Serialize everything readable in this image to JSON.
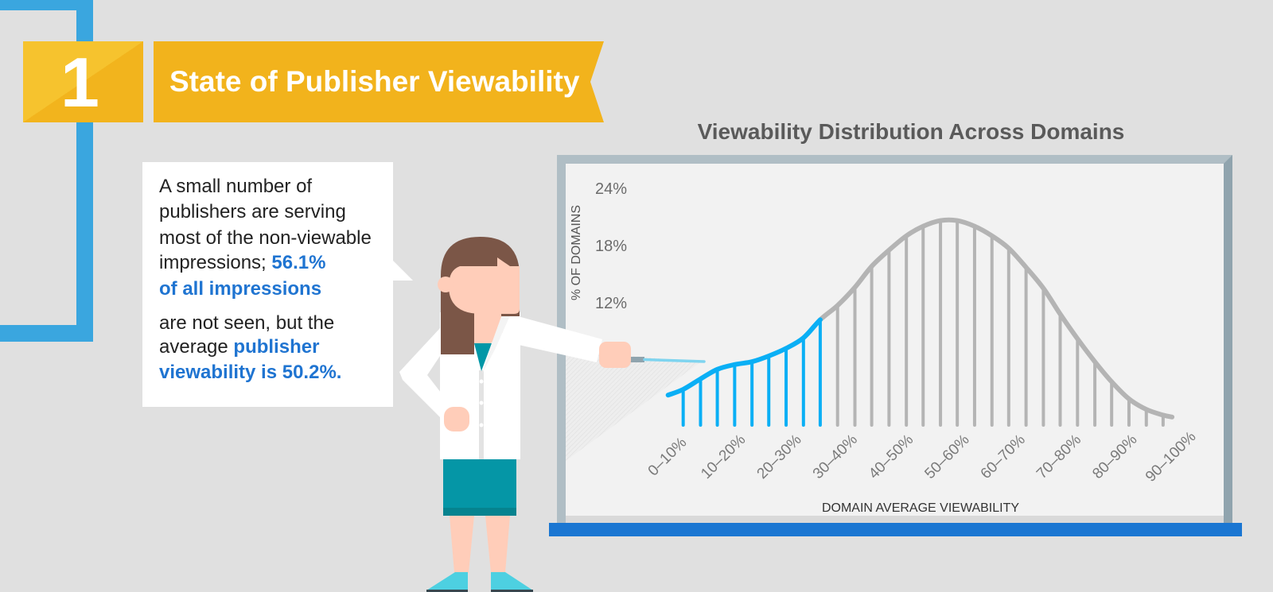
{
  "header": {
    "section_number": "1",
    "section_title": "State of Publisher Viewability"
  },
  "bubble": {
    "lines": [
      {
        "segments": [
          {
            "text": "A small number of",
            "emphasis": false
          }
        ]
      },
      {
        "segments": [
          {
            "text": "publishers are serving",
            "emphasis": false
          }
        ]
      },
      {
        "segments": [
          {
            "text": "most of the non-viewable",
            "emphasis": false
          }
        ]
      },
      {
        "segments": [
          {
            "text": "impressions; ",
            "emphasis": false
          },
          {
            "text": "56.1%",
            "emphasis": true
          }
        ]
      },
      {
        "segments": [
          {
            "text": "of all impressions",
            "emphasis": true
          }
        ]
      },
      {
        "segments": [
          {
            "text": "are not seen, but the",
            "emphasis": false
          }
        ]
      },
      {
        "segments": [
          {
            "text": "average ",
            "emphasis": false
          },
          {
            "text": "publisher",
            "emphasis": true
          }
        ]
      },
      {
        "segments": [
          {
            "text": "viewability is 50.2%.",
            "emphasis": true
          }
        ]
      }
    ]
  },
  "chart_data": {
    "type": "line",
    "title": "Viewability Distribution Across Domains",
    "xlabel": "DOMAIN AVERAGE VIEWABILITY",
    "ylabel": "% OF DOMAINS",
    "categories": [
      "0–10%",
      "10–20%",
      "20–30%",
      "30–40%",
      "40–50%",
      "50–60%",
      "60–70%",
      "70–80%",
      "80–90%",
      "90–100%"
    ],
    "xlim": [
      0,
      100
    ],
    "ylim": [
      0,
      24
    ],
    "yticks": [
      {
        "value": 24,
        "label": "24%"
      },
      {
        "value": 18,
        "label": "18%"
      },
      {
        "value": 12,
        "label": "12%"
      }
    ],
    "grid": false,
    "legend": "none",
    "highlight_count": 9,
    "curve_start": {
      "x": 5.1,
      "y": 2.4
    },
    "curve_end": {
      "x": 95.2,
      "y": 0.1
    },
    "series": [
      {
        "name": "% of domains",
        "x": [
          7.8,
          10.9,
          13.9,
          17.0,
          20.1,
          23.1,
          26.2,
          29.3,
          32.3,
          35.4,
          38.5,
          41.5,
          44.6,
          47.7,
          50.7,
          53.8,
          56.8,
          59.9,
          63.0,
          66.0,
          69.1,
          72.2,
          75.2,
          78.3,
          81.4,
          84.4,
          87.5,
          90.6,
          93.6
        ],
        "values": [
          3.0,
          4.1,
          5.1,
          5.6,
          5.9,
          6.5,
          7.3,
          8.4,
          10.3,
          11.8,
          13.7,
          15.9,
          17.6,
          19.1,
          20.1,
          20.7,
          20.7,
          20.1,
          19.1,
          17.8,
          15.8,
          13.6,
          10.9,
          8.3,
          5.9,
          3.8,
          2.0,
          0.9,
          0.3
        ]
      }
    ],
    "colors": {
      "highlight": "#0aaff5",
      "base": "#b4b4b4"
    }
  },
  "colors": {
    "banner_yellow": "#f2b31c",
    "outline_blue": "#3aa6df",
    "emphasis_blue": "#1f74d1",
    "tray_blue": "#1a76d2"
  }
}
